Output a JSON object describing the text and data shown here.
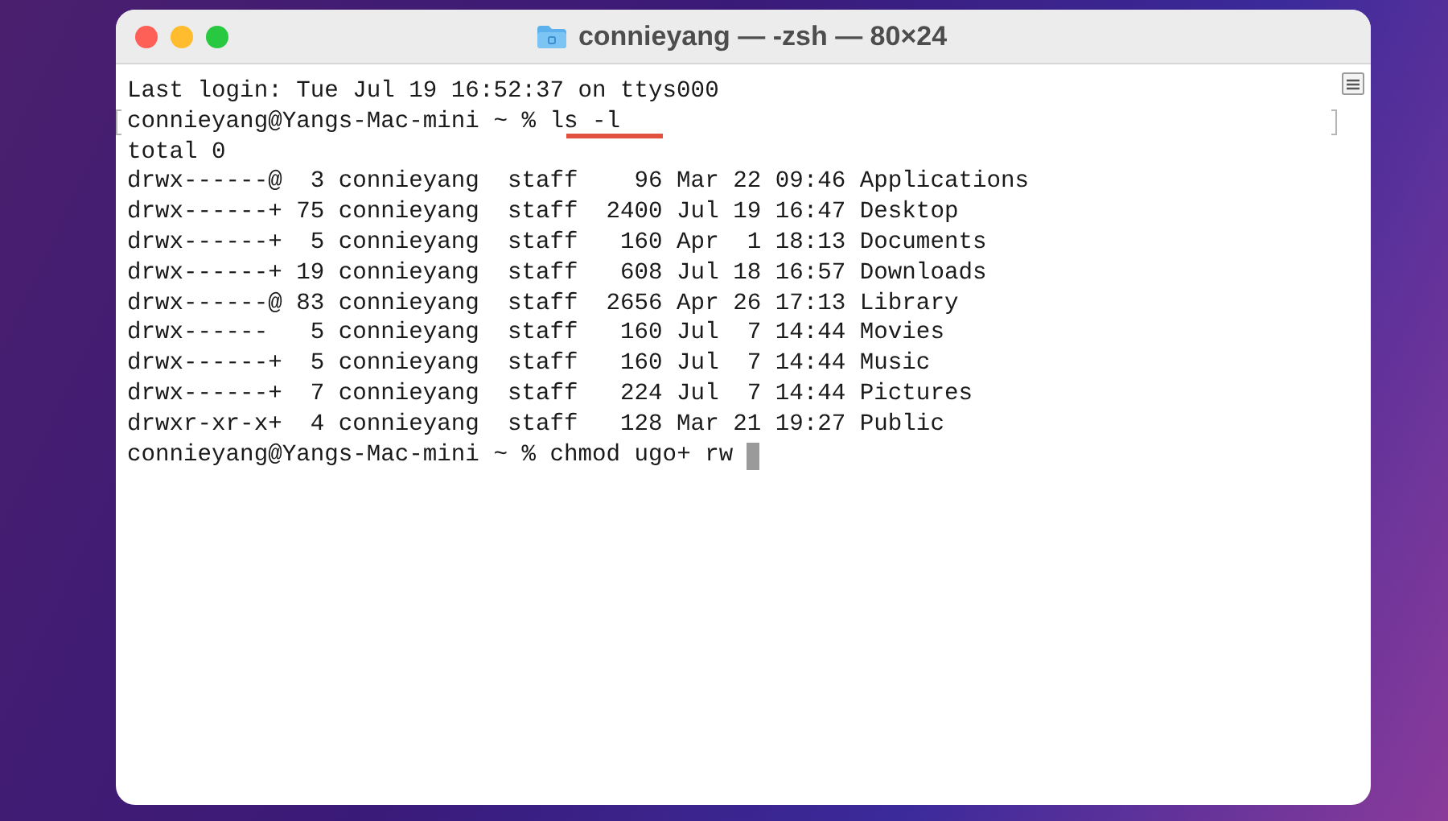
{
  "window": {
    "title": "connieyang — -zsh — 80×24"
  },
  "terminal": {
    "lines": [
      {
        "kind": "output",
        "text": "Last login: Tue Jul 19 16:52:37 on ttys000"
      },
      {
        "kind": "prompt",
        "prompt": "connieyang@Yangs-Mac-mini ~ %",
        "command": "ls -l",
        "underlined": true,
        "marked": true,
        "cursor": false
      },
      {
        "kind": "output",
        "text": "total 0"
      },
      {
        "kind": "output",
        "text": "drwx------@  3 connieyang  staff    96 Mar 22 09:46 Applications"
      },
      {
        "kind": "output",
        "text": "drwx------+ 75 connieyang  staff  2400 Jul 19 16:47 Desktop"
      },
      {
        "kind": "output",
        "text": "drwx------+  5 connieyang  staff   160 Apr  1 18:13 Documents"
      },
      {
        "kind": "output",
        "text": "drwx------+ 19 connieyang  staff   608 Jul 18 16:57 Downloads"
      },
      {
        "kind": "output",
        "text": "drwx------@ 83 connieyang  staff  2656 Apr 26 17:13 Library"
      },
      {
        "kind": "output",
        "text": "drwx------   5 connieyang  staff   160 Jul  7 14:44 Movies"
      },
      {
        "kind": "output",
        "text": "drwx------+  5 connieyang  staff   160 Jul  7 14:44 Music"
      },
      {
        "kind": "output",
        "text": "drwx------+  7 connieyang  staff   224 Jul  7 14:44 Pictures"
      },
      {
        "kind": "output",
        "text": "drwxr-xr-x+  4 connieyang  staff   128 Mar 21 19:27 Public"
      },
      {
        "kind": "prompt",
        "prompt": "connieyang@Yangs-Mac-mini ~ %",
        "command": "chmod ugo+ rw",
        "underlined": false,
        "marked": false,
        "cursor": true
      }
    ]
  }
}
